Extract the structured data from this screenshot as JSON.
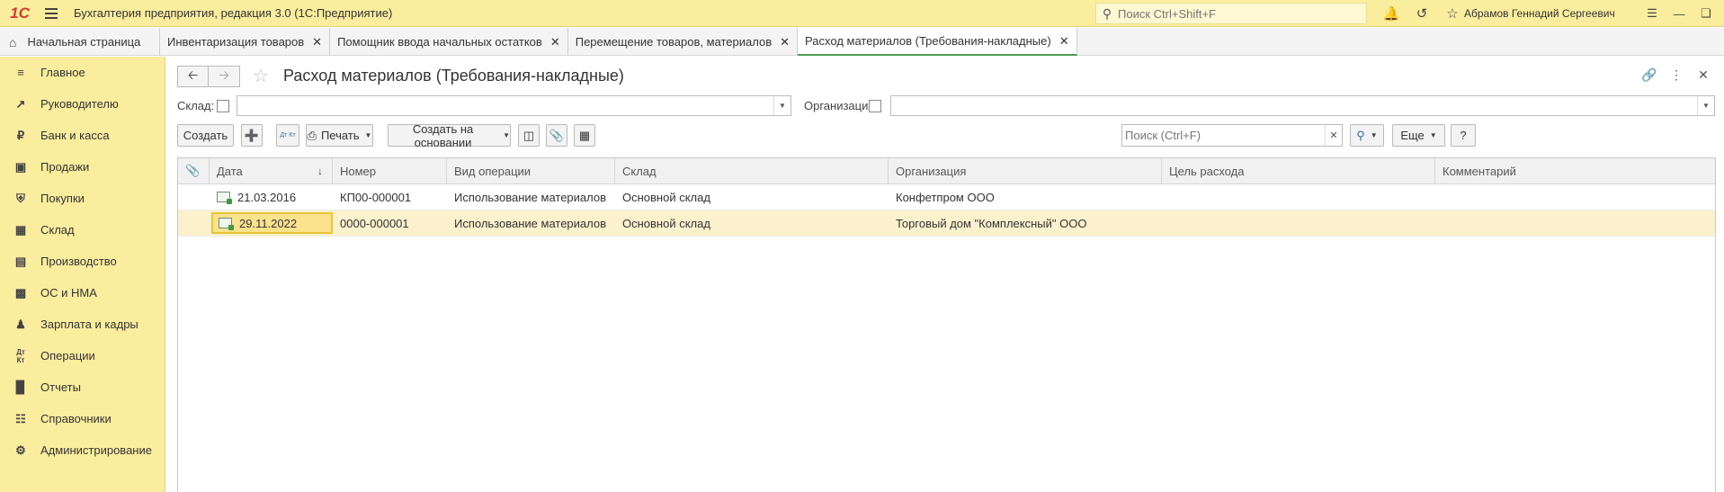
{
  "app": {
    "logo": "1С",
    "title": "Бухгалтерия предприятия, редакция 3.0  (1С:Предприятие)",
    "search_placeholder": "Поиск Ctrl+Shift+F",
    "user": "Абрамов Геннадий Сергеевич"
  },
  "tabs": [
    {
      "label": "Начальная страница"
    },
    {
      "label": "Инвентаризация товаров"
    },
    {
      "label": "Помощник ввода начальных остатков"
    },
    {
      "label": "Перемещение товаров, материалов"
    },
    {
      "label": "Расход материалов (Требования-накладные)",
      "active": true
    }
  ],
  "sidebar": {
    "items": [
      {
        "label": "Главное",
        "icon": "menu-lines-icon"
      },
      {
        "label": "Руководителю",
        "icon": "trend-up-icon"
      },
      {
        "label": "Банк и касса",
        "icon": "ruble-coin-icon"
      },
      {
        "label": "Продажи",
        "icon": "shopping-bag-icon"
      },
      {
        "label": "Покупки",
        "icon": "cart-icon"
      },
      {
        "label": "Склад",
        "icon": "warehouse-grid-icon"
      },
      {
        "label": "Производство",
        "icon": "factory-icon"
      },
      {
        "label": "ОС и НМА",
        "icon": "truck-icon"
      },
      {
        "label": "Зарплата и кадры",
        "icon": "person-icon"
      },
      {
        "label": "Операции",
        "icon": "dt-kt-icon"
      },
      {
        "label": "Отчеты",
        "icon": "bar-chart-icon"
      },
      {
        "label": "Справочники",
        "icon": "book-icon"
      },
      {
        "label": "Администрирование",
        "icon": "gear-icon"
      }
    ]
  },
  "form": {
    "title": "Расход материалов (Требования-накладные)",
    "filters": {
      "warehouse_label": "Склад:",
      "organization_label": "Организация:"
    },
    "toolbar": {
      "create": "Создать",
      "print": "Печать",
      "create_based_on": "Создать на основании",
      "dt_kt": "Дт Кт",
      "search_placeholder": "Поиск (Ctrl+F)",
      "more": "Еще",
      "help": "?"
    },
    "table": {
      "columns": [
        "Дата",
        "Номер",
        "Вид операции",
        "Склад",
        "Организация",
        "Цель расхода",
        "Комментарий"
      ],
      "rows": [
        {
          "date": "21.03.2016",
          "number": "КП00-000001",
          "operation": "Использование материалов",
          "warehouse": "Основной склад",
          "organization": "Конфетпром ООО",
          "purpose": "",
          "comment": ""
        },
        {
          "date": "29.11.2022",
          "number": "0000-000001",
          "operation": "Использование материалов",
          "warehouse": "Основной склад",
          "organization": "Торговый дом \"Комплексный\" ООО",
          "purpose": "",
          "comment": "",
          "selected": true
        }
      ]
    }
  },
  "colors": {
    "panel_yellow": "#fbed9e",
    "selection": "#fbf1cc",
    "active_tab_line": "#4f9a52",
    "logo_red": "#d33b2a"
  }
}
